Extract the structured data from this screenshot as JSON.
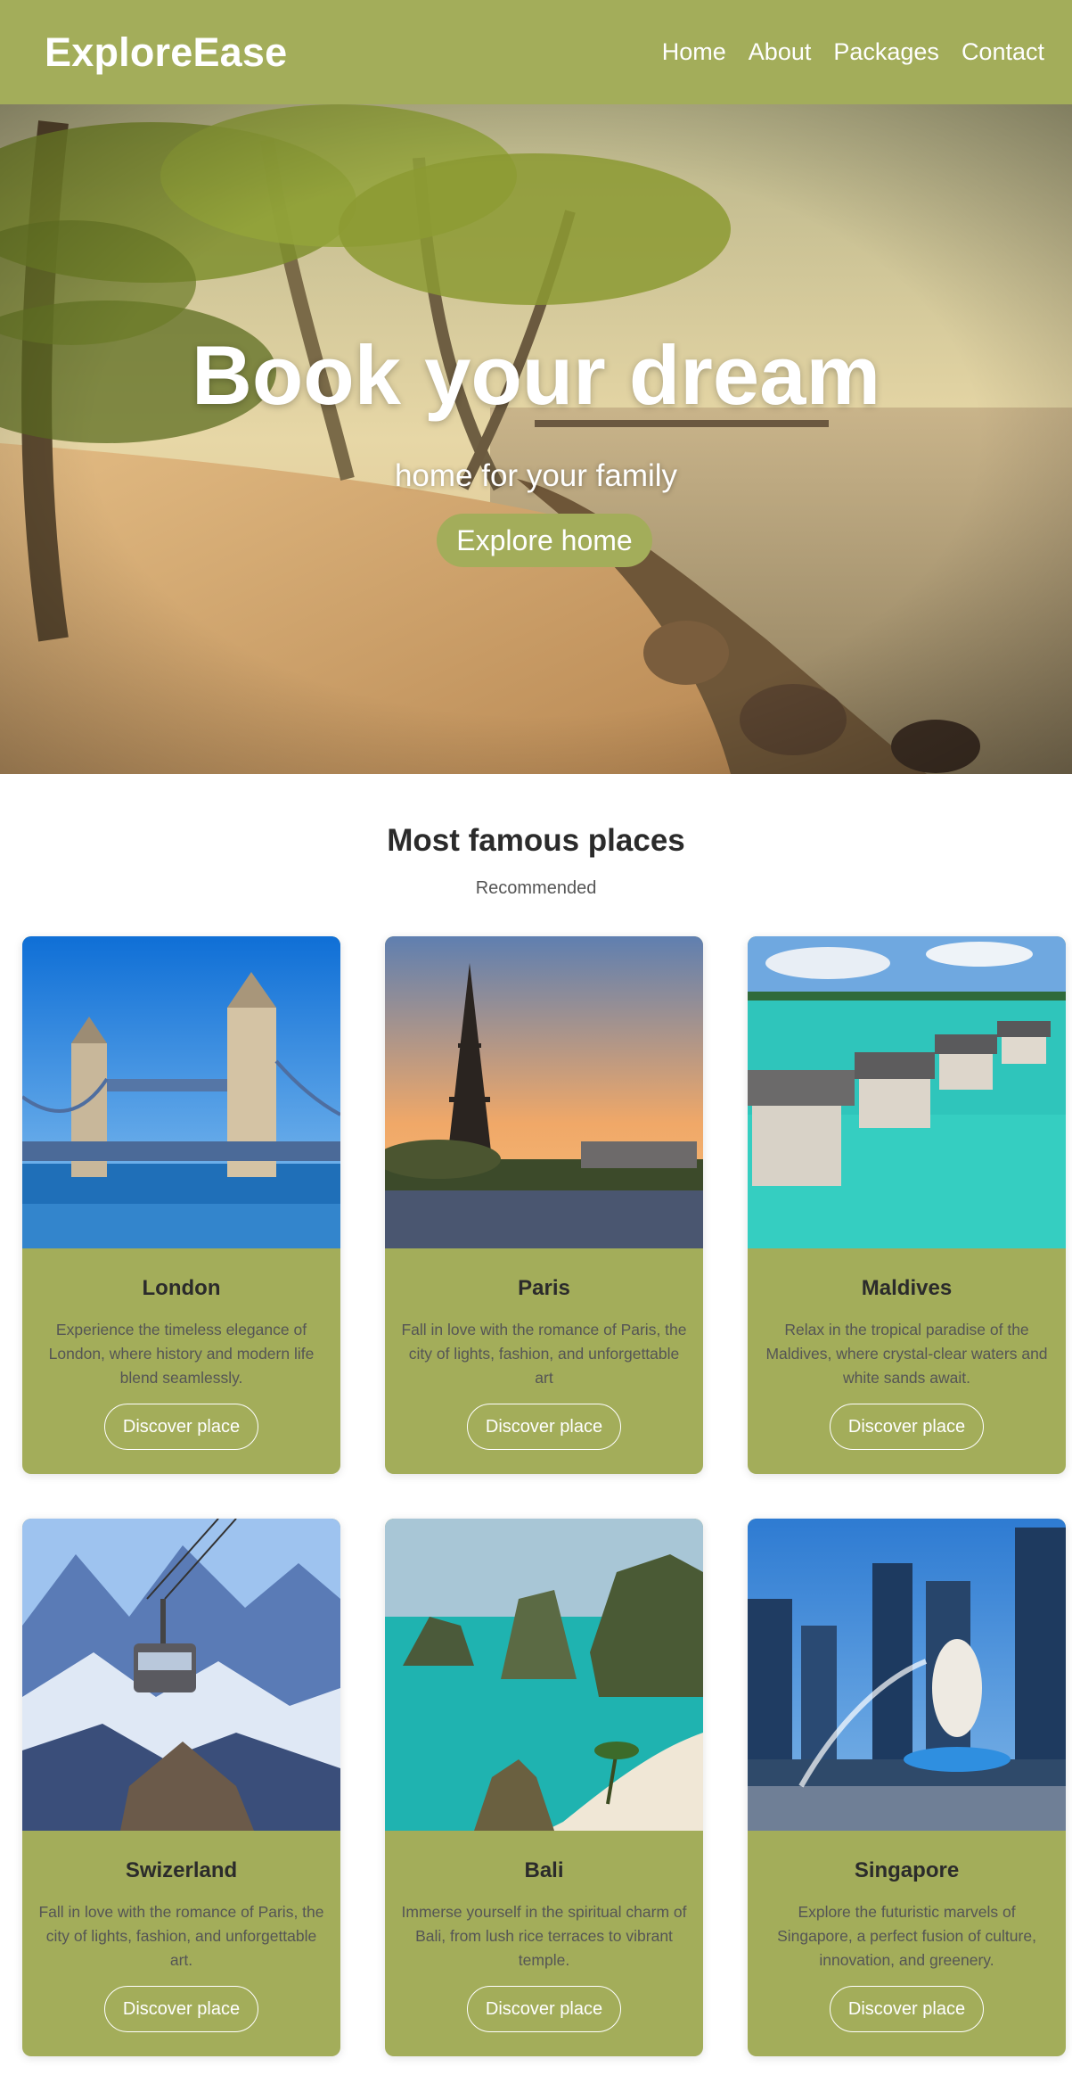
{
  "navbar": {
    "brand": "ExploreEase",
    "links": [
      "Home",
      "About",
      "Packages",
      "Contact"
    ]
  },
  "hero": {
    "title": "Book your dream",
    "subtitle": "home for your family",
    "button": "Explore home"
  },
  "section": {
    "title": "Most famous places",
    "subtitle": "Recommended"
  },
  "cards": [
    {
      "title": "London",
      "text": "Experience the timeless elegance of London, where history and modern life blend seamlessly.",
      "button": "Discover place"
    },
    {
      "title": "Paris",
      "text": "Fall in love with the romance of Paris, the city of lights, fashion, and unforgettable art",
      "button": "Discover place"
    },
    {
      "title": "Maldives",
      "text": "Relax in the tropical paradise of the Maldives, where crystal-clear waters and white sands await.",
      "button": "Discover place"
    },
    {
      "title": "Swizerland",
      "text": "Fall in love with the romance of Paris, the city of lights, fashion, and unforgettable art.",
      "button": "Discover place"
    },
    {
      "title": "Bali",
      "text": "Immerse yourself in the spiritual charm of Bali, from lush rice terraces to vibrant temple.",
      "button": "Discover place"
    },
    {
      "title": "Singapore",
      "text": "Explore the futuristic marvels of Singapore, a perfect fusion of culture, innovation, and greenery.",
      "button": "Discover place"
    }
  ],
  "colors": {
    "accent": "#a3ad5a",
    "text": "#2b2b2b",
    "muted": "#555555"
  }
}
